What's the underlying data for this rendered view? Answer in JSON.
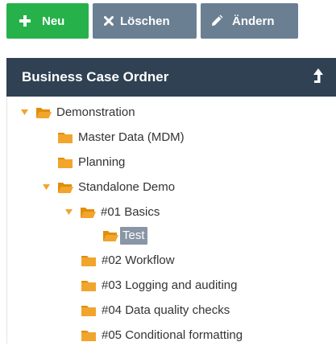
{
  "toolbar": {
    "new_label": "Neu",
    "delete_label": "Löschen",
    "edit_label": "Ändern"
  },
  "panel": {
    "title": "Business Case Ordner"
  },
  "tree": {
    "root": "Demonstration",
    "master_data": "Master Data (MDM)",
    "planning": "Planning",
    "standalone_demo": "Standalone Demo",
    "basics": "#01 Basics",
    "test": "Test",
    "workflow": "#02 Workflow",
    "logging": "#03 Logging and auditing",
    "data_quality": "#04 Data quality checks",
    "conditional_formatting": "#05 Conditional formatting"
  },
  "colors": {
    "new_button": "#26b14b",
    "secondary_button": "#6b7f93",
    "panel_header": "#2f4152",
    "folder": "#f1a52c",
    "selected": "#8896a5"
  },
  "icons": {
    "new": "plus-icon",
    "delete": "x-icon",
    "edit": "pencil-icon",
    "collapse": "arrow-up-icon",
    "folder": "folder-icon",
    "folder_open": "folder-open-icon",
    "expanded": "caret-down-icon"
  }
}
